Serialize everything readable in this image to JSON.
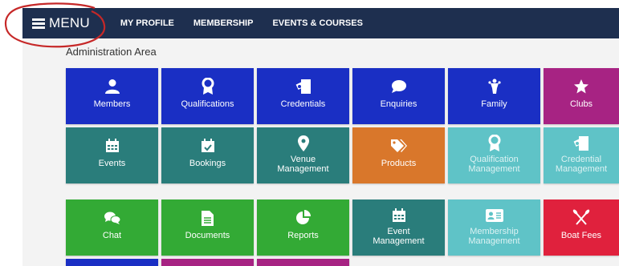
{
  "navbar": {
    "menu_label": "MENU",
    "links": [
      "MY PROFILE",
      "MEMBERSHIP",
      "EVENTS & COURSES"
    ]
  },
  "area_title": "Administration Area",
  "tiles": {
    "members": {
      "label": "Members",
      "color": "#1a2fc4",
      "icon": "person-icon"
    },
    "qualifications": {
      "label": "Qualifications",
      "color": "#1a2fc4",
      "icon": "badge-icon"
    },
    "credentials": {
      "label": "Credentials",
      "color": "#1a2fc4",
      "icon": "credential-icon"
    },
    "enquiries": {
      "label": "Enquiries",
      "color": "#1a2fc4",
      "icon": "chat-bubble-icon"
    },
    "family": {
      "label": "Family",
      "color": "#1a2fc4",
      "icon": "family-icon"
    },
    "clubs": {
      "label": "Clubs",
      "color": "#a72383",
      "icon": "star-icon"
    },
    "events": {
      "label": "Events",
      "color": "#2a7d7b",
      "icon": "calendar-icon"
    },
    "bookings": {
      "label": "Bookings",
      "color": "#2a7d7b",
      "icon": "calendar-check-icon"
    },
    "venue_management": {
      "label_line1": "Venue",
      "label_line2": "Management",
      "color": "#2a7d7b",
      "icon": "map-pin-icon"
    },
    "products": {
      "label": "Products",
      "color": "#d9772b",
      "icon": "tags-icon"
    },
    "qualification_management": {
      "label_line1": "Qualification",
      "label_line2": "Management",
      "color": "#5fc3c7",
      "icon": "badge-icon"
    },
    "credential_management": {
      "label_line1": "Credential",
      "label_line2": "Management",
      "color": "#5fc3c7",
      "icon": "credential-icon"
    },
    "chat": {
      "label": "Chat",
      "color": "#33aa35",
      "icon": "chat-icon"
    },
    "documents": {
      "label": "Documents",
      "color": "#33aa35",
      "icon": "document-icon"
    },
    "reports": {
      "label": "Reports",
      "color": "#33aa35",
      "icon": "pie-chart-icon"
    },
    "event_management": {
      "label_line1": "Event",
      "label_line2": "Management",
      "color": "#2a7d7b",
      "icon": "calendar-icon"
    },
    "membership_management": {
      "label_line1": "Membership",
      "label_line2": "Management",
      "color": "#5fc3c7",
      "icon": "id-card-icon"
    },
    "boat_fees": {
      "label": "Boat Fees",
      "color": "#e0213d",
      "icon": "crossed-oars-icon"
    }
  },
  "partial_tiles": {
    "colors": [
      "#1a2fc4",
      "#a72383",
      "#a72383"
    ]
  },
  "highlight": {
    "color": "#c62828"
  }
}
